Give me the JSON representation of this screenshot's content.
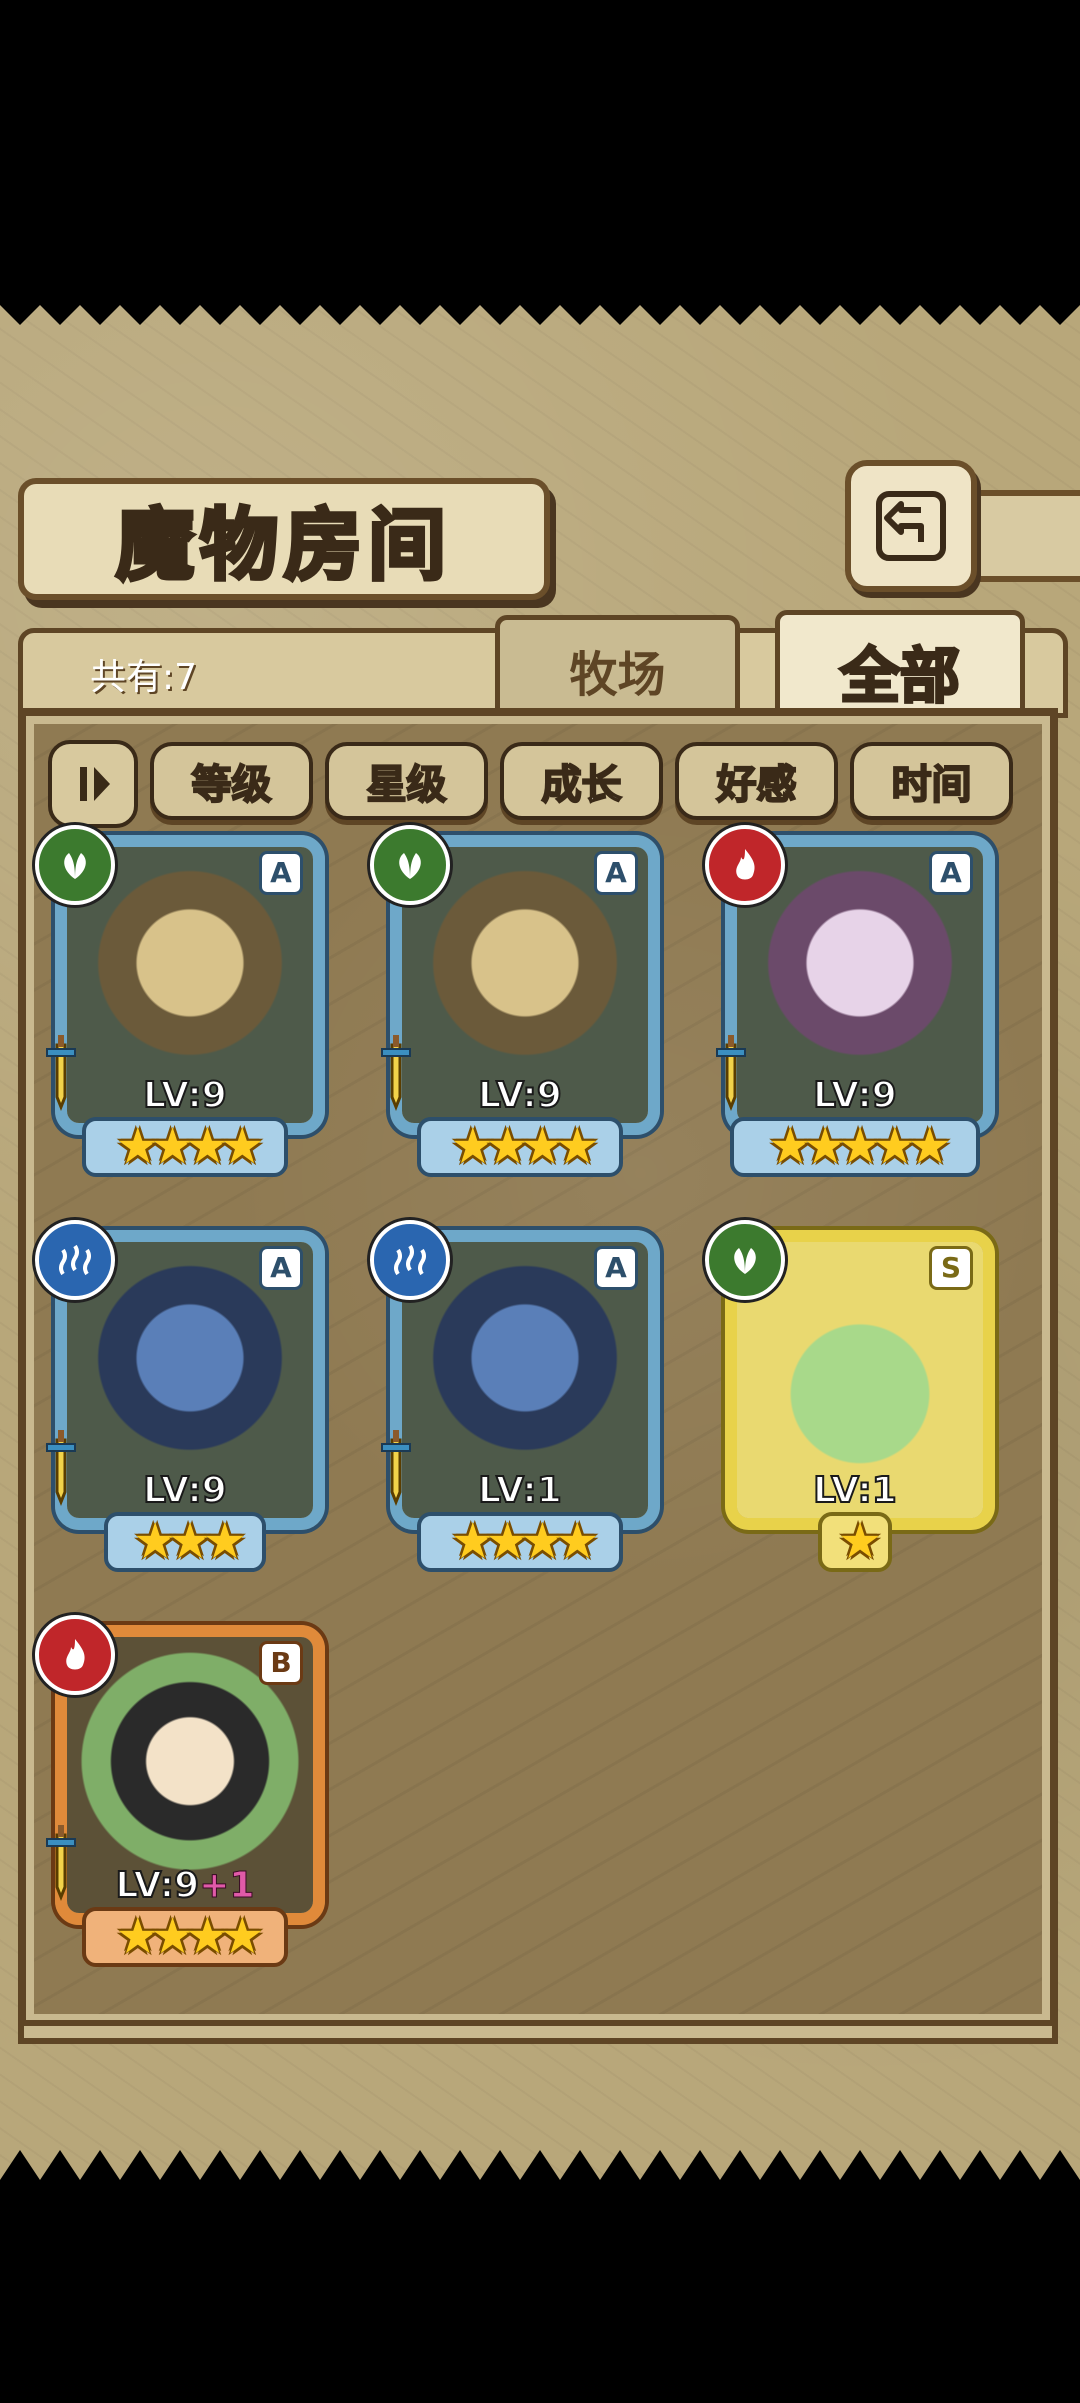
{
  "header": {
    "title": "魔物房间",
    "count_label": "共有:7"
  },
  "tabs": [
    {
      "label": "牧场",
      "active": false
    },
    {
      "label": "全部",
      "active": true
    }
  ],
  "filters": [
    "等级",
    "星级",
    "成长",
    "好感",
    "时间"
  ],
  "monsters": [
    {
      "element": "nature",
      "rank": "A",
      "level": "LV:9",
      "bonus": "",
      "stars": 4,
      "frame": "blue"
    },
    {
      "element": "nature",
      "rank": "A",
      "level": "LV:9",
      "bonus": "",
      "stars": 4,
      "frame": "blue"
    },
    {
      "element": "fire",
      "rank": "A",
      "level": "LV:9",
      "bonus": "",
      "stars": 5,
      "frame": "blue"
    },
    {
      "element": "water",
      "rank": "A",
      "level": "LV:9",
      "bonus": "",
      "stars": 3,
      "frame": "blue"
    },
    {
      "element": "water",
      "rank": "A",
      "level": "LV:1",
      "bonus": "",
      "stars": 4,
      "frame": "blue"
    },
    {
      "element": "nature",
      "rank": "S",
      "level": "LV:1",
      "bonus": "",
      "stars": 1,
      "frame": "gold"
    },
    {
      "element": "fire",
      "rank": "B",
      "level": "LV:9",
      "bonus": "+1",
      "stars": 4,
      "frame": "bronze"
    }
  ],
  "colors": {
    "map_bg": "#b8a77a",
    "panel_border": "#5e4525",
    "star": "#ffcc1f"
  }
}
